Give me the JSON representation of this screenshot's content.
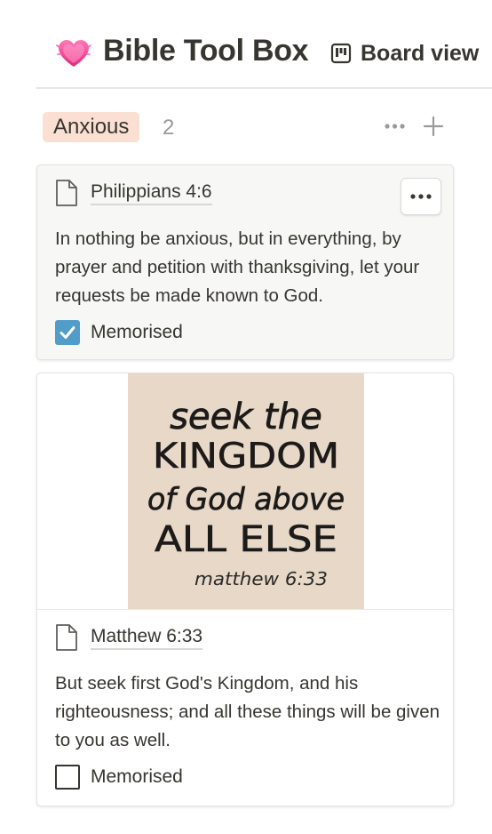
{
  "page": {
    "emoji": "heart-emoji",
    "title": "Bible Tool Box",
    "view_tab": {
      "icon": "board-icon",
      "label": "Board view"
    }
  },
  "group": {
    "label": "Anxious",
    "count": "2",
    "pill_color": "#fadfd2"
  },
  "cards": [
    {
      "title": "Philippians 4:6",
      "text": "In nothing be anxious, but in everything, by prayer and petition with thanksgiving, let your requests be made known to God.",
      "property_label": "Memorised",
      "memorised": true
    },
    {
      "title": "Matthew 6:33",
      "text": "But seek first God's Kingdom, and his righteousness; and all these things will be given to you as well.",
      "property_label": "Memorised",
      "memorised": false,
      "cover": {
        "lines": [
          "seek the",
          "KINGDOM",
          "of God above",
          "ALL ELSE",
          "matthew 6:33"
        ],
        "background": "#e8d8c8"
      }
    }
  ],
  "colors": {
    "text": "#37352f",
    "checkbox_checked": "#529cca",
    "muted": "#9b9a97"
  }
}
